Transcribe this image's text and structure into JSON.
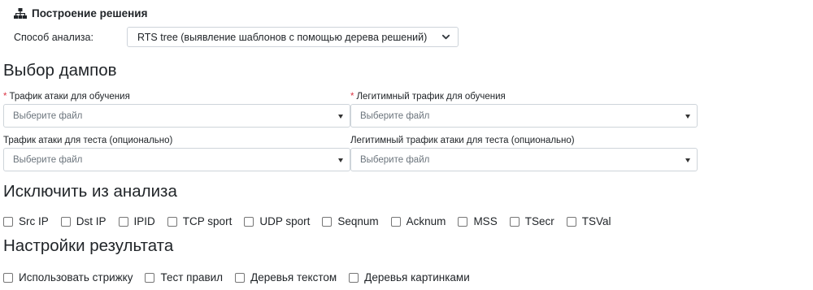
{
  "build": {
    "title": "Построение решения",
    "icon": "sitemap-icon",
    "method_label": "Способ анализа:",
    "method_value": "RTS tree (выявление шаблонов с помощью дерева решений)"
  },
  "dumps": {
    "heading": "Выбор дампов",
    "required_mark": "*",
    "fields": [
      {
        "label": "Трафик атаки для обучения",
        "placeholder": "Выберите файл"
      },
      {
        "label": "Легитимный трафик для обучения",
        "placeholder": "Выберите файл"
      },
      {
        "label": "Трафик атаки для теста (опционально)",
        "placeholder": "Выберите файл"
      },
      {
        "label": "Легитимный трафик атаки для теста (опционально)",
        "placeholder": "Выберите файл"
      }
    ]
  },
  "exclude": {
    "heading": "Исключить из анализа",
    "options": [
      "Src IP",
      "Dst IP",
      "IPID",
      "TCP sport",
      "UDP sport",
      "Seqnum",
      "Acknum",
      "MSS",
      "TSecr",
      "TSVal"
    ]
  },
  "result": {
    "heading": "Настройки результата",
    "options": [
      "Использовать стрижку",
      "Тест правил",
      "Деревья текстом",
      "Деревья картинками"
    ]
  }
}
